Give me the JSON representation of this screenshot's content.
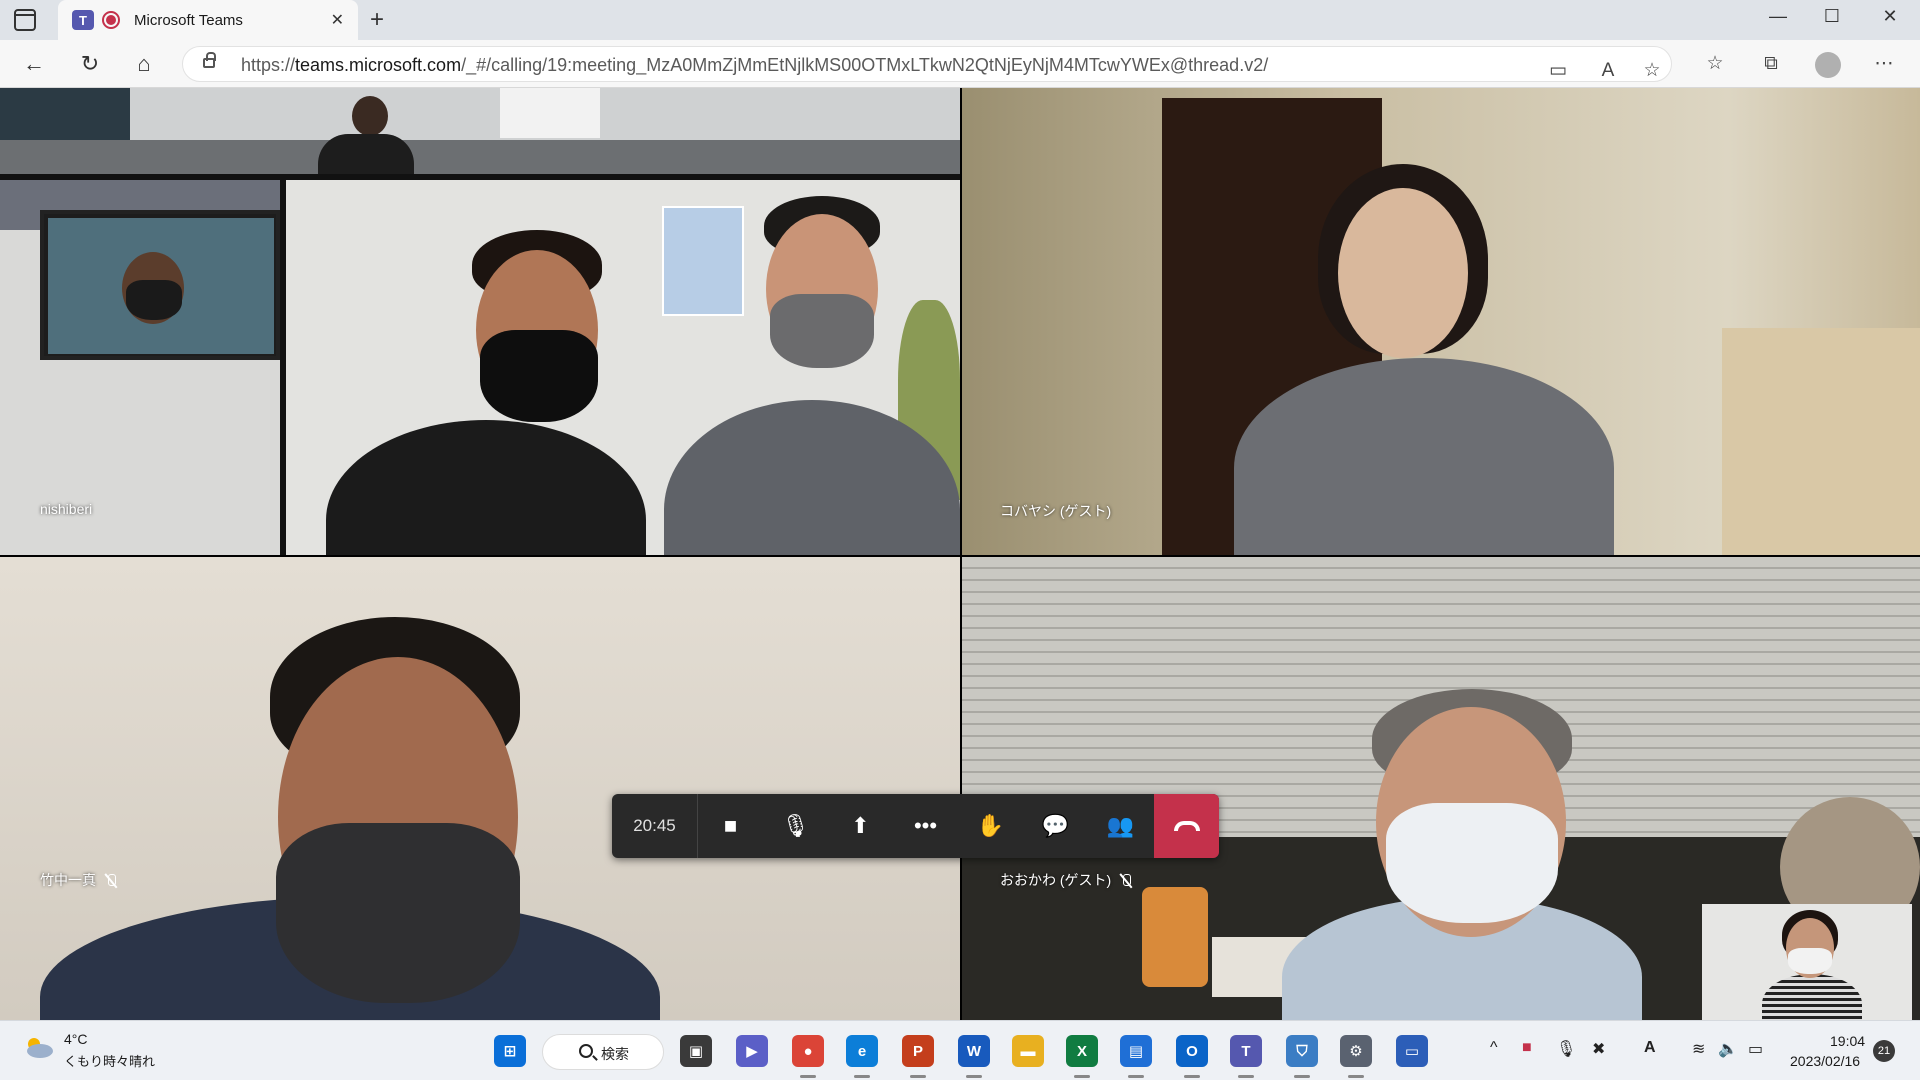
{
  "browser": {
    "tab_title": "Microsoft Teams",
    "teams_logo_letter": "T",
    "url_prefix": "https://",
    "url_host": "teams.microsoft.com",
    "url_path": "/_#/calling/19:meeting_MzA0MmZjMmEtNjlkMS00OTMxLTkwN2QtNjEyNjM4MTcwYWEx@thread.v2/",
    "new_tab_glyph": "+",
    "close_glyph": "✕",
    "minimize_glyph": "—",
    "maximize_glyph": "☐",
    "back_glyph": "←",
    "refresh_glyph": "↻",
    "home_glyph": "⌂",
    "camera_glyph": "▭",
    "read_aloud_glyph": "A",
    "favorite_add_glyph": "☆",
    "favorites_glyph": "☆",
    "collections_glyph": "⧉",
    "menu_glyph": "⋯"
  },
  "participants": [
    {
      "name": "nishiberi",
      "muted": false
    },
    {
      "name": "コバヤシ (ゲスト)",
      "muted": false
    },
    {
      "name": "竹中一真",
      "muted": true
    },
    {
      "name": "おおかわ (ゲスト)",
      "muted": true
    }
  ],
  "call_controls": {
    "timer": "20:45",
    "camera_glyph": "■",
    "mic_glyph": "🎙",
    "share_glyph": "⬆",
    "more_glyph": "•••",
    "raise_hand_glyph": "✋",
    "chat_glyph": "💬",
    "people_glyph": "👥"
  },
  "taskbar": {
    "weather_temp": "4°C",
    "weather_desc": "くもり時々晴れ",
    "search_label": "検索",
    "clock_time": "19:04",
    "clock_date": "2023/02/16",
    "notification_count": "21",
    "apps": [
      {
        "name": "start",
        "glyph": "⊞",
        "color": "#0a6fd8"
      },
      {
        "name": "task-view",
        "glyph": "▣",
        "color": "#3a3a3a"
      },
      {
        "name": "teams-chat",
        "glyph": "▶",
        "color": "#5b5fc7"
      },
      {
        "name": "chrome",
        "glyph": "●",
        "color": "#db4437"
      },
      {
        "name": "edge",
        "glyph": "e",
        "color": "#0c7ed8"
      },
      {
        "name": "powerpoint",
        "glyph": "P",
        "color": "#c43e1c"
      },
      {
        "name": "word",
        "glyph": "W",
        "color": "#185abd"
      },
      {
        "name": "file-explorer",
        "glyph": "▬",
        "color": "#e8b020"
      },
      {
        "name": "excel",
        "glyph": "X",
        "color": "#107c41"
      },
      {
        "name": "notepad-blue",
        "glyph": "▤",
        "color": "#1f6fd6"
      },
      {
        "name": "outlook",
        "glyph": "O",
        "color": "#0a64c8"
      },
      {
        "name": "teams",
        "glyph": "T",
        "color": "#5558af"
      },
      {
        "name": "defender",
        "glyph": "⛉",
        "color": "#3b7dc4"
      },
      {
        "name": "settings",
        "glyph": "⚙",
        "color": "#5a6270"
      },
      {
        "name": "remote",
        "glyph": "▭",
        "color": "#2c5eb8"
      }
    ],
    "tray": {
      "chevron_glyph": "^",
      "mic_glyph": "🎙",
      "close_glyph": "✖",
      "a_glyph": "A",
      "wifi_glyph": "≋",
      "volume_glyph": "🔈",
      "battery_glyph": "▭"
    }
  }
}
